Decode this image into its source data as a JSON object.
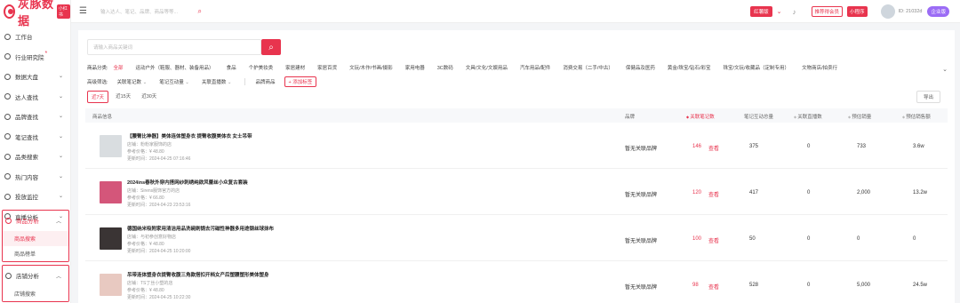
{
  "brand": {
    "name": "灰豚数据",
    "badge": "小红书"
  },
  "sidebar": {
    "items": [
      {
        "label": "工作台",
        "chev": false
      },
      {
        "label": "行业研究院",
        "chev": false,
        "sup": "*"
      },
      {
        "label": "数据大盘",
        "chev": true
      },
      {
        "label": "达人查找",
        "chev": true
      },
      {
        "label": "品牌查找",
        "chev": true
      },
      {
        "label": "笔记查找",
        "chev": true
      },
      {
        "label": "品类搜索",
        "chev": true
      },
      {
        "label": "热门内容",
        "chev": true
      },
      {
        "label": "投放监控",
        "chev": true
      },
      {
        "label": "直播分析",
        "chev": true
      }
    ],
    "goods_group": {
      "label": "商品分析",
      "subs": [
        "商品搜索",
        "商品榜单"
      ]
    },
    "shop_group": {
      "label": "店铺分析",
      "subs": [
        "店铺搜索"
      ]
    }
  },
  "topbar": {
    "search_placeholder": "输入达人、笔记、品牌、商品等等...",
    "red_chip": "红薯版",
    "invite": "推荐得会员",
    "mini": "小程序",
    "uid": "ID: 21032d",
    "vip": "企业版"
  },
  "search": {
    "placeholder": "请输入商品关键词"
  },
  "categories": {
    "label": "商品分类:",
    "items": [
      "全部",
      "运动户外（鞋服、器材、装备用品）",
      "食品",
      "个护美妆类",
      "家居建材",
      "家居百货",
      "文玩/木作/书画/摄影",
      "家用电器",
      "3C数码",
      "文具/文化/文娱用品",
      "汽车用品/配件",
      "消费交易（二手/中古）",
      "保健品及医药",
      "黄金/珠宝/钻石/彩宝",
      "珠宝/文玩/收藏品（定制专用）",
      "文物商店/拍卖行"
    ]
  },
  "filters": {
    "label": "高级筛选:",
    "selects": [
      "关联笔记数",
      "笔记互动量",
      "关联直播数"
    ],
    "brand_goods": "品牌商品",
    "tag_btn": "+ 添加标签"
  },
  "time_tabs": [
    "近7天",
    "近15天",
    "近30天"
  ],
  "export": "导出",
  "columns": {
    "product": "商品信息",
    "brand": "品牌",
    "notes": "关联笔记数",
    "interact": "笔记互动总量",
    "lives": "关联直播数",
    "sales": "预估销量",
    "gmv": "预估销售额"
  },
  "rows": [
    {
      "name": "【腰臀比神器】美体连体塑身衣 提臀收腹美体衣 女士吊带",
      "shop": "店铺：粉粉家服饰的店",
      "price": "参考价格：¥ 48.80",
      "updated": "更新时间：2024-04-25 07:16:46",
      "brand": "暂无关联品牌",
      "notes": "146",
      "view": "查看",
      "interact": "375",
      "lives": "0",
      "sales": "733",
      "gmv": "3.6w",
      "color": "#d9dde0"
    },
    {
      "name": "2024ins春秋外穿内搭网纱刺绣纯欲风蕾丝小众复古套装",
      "shop": "店铺：Sirens服饰官方的店",
      "price": "参考价格：¥ 66.80",
      "updated": "更新时间：2024-04-23 23:53:16",
      "brand": "暂无关联品牌",
      "notes": "120",
      "view": "查看",
      "interact": "417",
      "lives": "0",
      "sales": "2,000",
      "gmv": "13.2w",
      "color": "#d4567a"
    },
    {
      "name": "德国纳米吸附家用清洁用品洗碗刷锅去污磁性神器多用途钢丝球抹布",
      "shop": "店铺：与初参创意好物店",
      "price": "参考价格：¥ 48.80",
      "updated": "更新时间：2024-04-25 10:20:00",
      "brand": "暂无关联品牌",
      "notes": "100",
      "view": "查看",
      "interact": "50",
      "lives": "0",
      "sales": "0",
      "gmv": "0",
      "color": "#3a3434"
    },
    {
      "name": "吊带连体塑身衣提臀收腹三角款搭扣开档女产后塑腰塑形美体塑身",
      "shop": "店铺：TS丁丝小塑的店",
      "price": "参考价格：¥ 48.80",
      "updated": "更新时间：2024-04-25 10:22:30",
      "brand": "暂无关联品牌",
      "notes": "98",
      "view": "查看",
      "interact": "528",
      "lives": "0",
      "sales": "5,000",
      "gmv": "24.5w",
      "color": "#e8c9c1"
    }
  ]
}
